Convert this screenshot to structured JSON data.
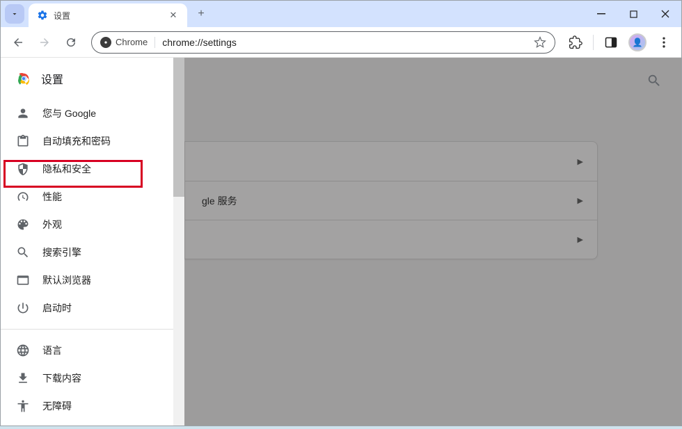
{
  "tab": {
    "title": "设置"
  },
  "addr": {
    "chip": "Chrome",
    "url": "chrome://settings"
  },
  "sidebar": {
    "title": "设置",
    "items": [
      {
        "label": "您与 Google"
      },
      {
        "label": "自动填充和密码"
      },
      {
        "label": "隐私和安全"
      },
      {
        "label": "性能"
      },
      {
        "label": "外观"
      },
      {
        "label": "搜索引擎"
      },
      {
        "label": "默认浏览器"
      },
      {
        "label": "启动时"
      }
    ],
    "items2": [
      {
        "label": "语言"
      },
      {
        "label": "下载内容"
      },
      {
        "label": "无障碍"
      }
    ]
  },
  "main": {
    "row_partial": "gle 服务"
  }
}
